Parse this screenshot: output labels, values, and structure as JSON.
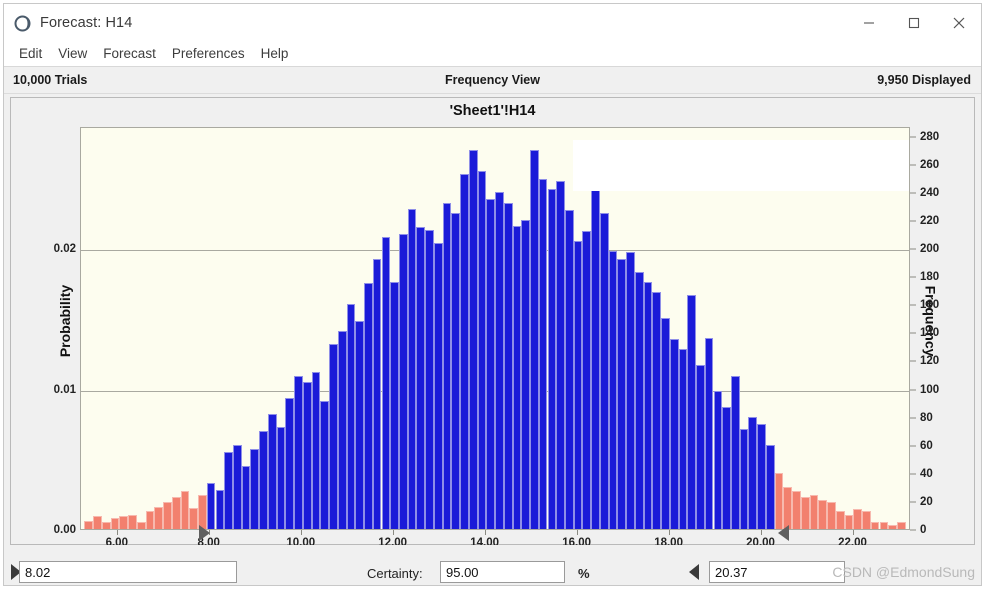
{
  "window": {
    "title": "Forecast: H14",
    "icon": "crystal-ball-icon",
    "minimize_label": "–",
    "maximize_label": "□",
    "close_label": "✕"
  },
  "menubar": {
    "items": [
      {
        "label": "Edit"
      },
      {
        "label": "View"
      },
      {
        "label": "Forecast"
      },
      {
        "label": "Preferences"
      },
      {
        "label": "Help"
      }
    ]
  },
  "status": {
    "trials": "10,000 Trials",
    "view_mode": "Frequency View",
    "displayed": "9,950 Displayed"
  },
  "controls": {
    "lower_bound": "8.02",
    "certainty_label": "Certainty:",
    "certainty_value": "95.00",
    "percent_symbol": "%",
    "upper_bound": "20.37",
    "lower_marker_icon": "triangle-right-icon",
    "upper_marker_icon": "triangle-left-icon",
    "watermark": "CSDN @EdmondSung"
  },
  "colors": {
    "inside_bar": "#1b1bd8",
    "outside_bar": "#f2806e",
    "plot_background": "#fdfdef",
    "panel_background": "#f0f0f0"
  },
  "chart_data": {
    "type": "bar",
    "title": "'Sheet1'!H14",
    "xlabel": "",
    "ylabel": "Probability",
    "y2label": "Frequency",
    "grid": true,
    "legend": "empty-box",
    "xlim": [
      5.2,
      23.25
    ],
    "ylim": [
      0,
      0.0287
    ],
    "y2lim": [
      0,
      287
    ],
    "yticks": [
      0.0,
      0.01,
      0.02
    ],
    "yticklabels": [
      "0.00",
      "0.01",
      "0.02"
    ],
    "y2ticks": [
      0,
      20,
      40,
      60,
      80,
      100,
      120,
      140,
      160,
      180,
      200,
      220,
      240,
      260,
      280
    ],
    "y2ticklabels": [
      "0",
      "20",
      "40",
      "60",
      "80",
      "100",
      "120",
      "140",
      "160",
      "180",
      "200",
      "220",
      "240",
      "260",
      "280"
    ],
    "xticks": [
      6.0,
      8.0,
      10.0,
      12.0,
      14.0,
      16.0,
      18.0,
      20.0,
      22.0
    ],
    "xticklabels": [
      "6.00",
      "8.00",
      "10.00",
      "12.00",
      "14.00",
      "16.00",
      "18.00",
      "20.00",
      "22.00"
    ],
    "total_trials": 10000,
    "displayed_trials": 9950,
    "certainty_percent": 95.0,
    "lower_cut": 8.02,
    "upper_cut": 20.37,
    "bin_width": 0.19,
    "bin_start": 5.27,
    "bin_centers": [
      5.37,
      5.56,
      5.75,
      5.94,
      6.13,
      6.32,
      6.51,
      6.7,
      6.89,
      7.08,
      7.27,
      7.46,
      7.65,
      7.84,
      8.03,
      8.22,
      8.41,
      8.6,
      8.79,
      8.98,
      9.17,
      9.36,
      9.55,
      9.74,
      9.93,
      10.12,
      10.31,
      10.5,
      10.69,
      10.88,
      11.07,
      11.26,
      11.45,
      11.64,
      11.83,
      12.02,
      12.21,
      12.4,
      12.59,
      12.78,
      12.97,
      13.16,
      13.35,
      13.54,
      13.73,
      13.92,
      14.11,
      14.3,
      14.49,
      14.68,
      14.87,
      15.06,
      15.25,
      15.44,
      15.63,
      15.82,
      16.01,
      16.2,
      16.39,
      16.58,
      16.77,
      16.96,
      17.15,
      17.34,
      17.53,
      17.72,
      17.91,
      18.1,
      18.29,
      18.48,
      18.67,
      18.86,
      19.05,
      19.24,
      19.43,
      19.62,
      19.81,
      20.0,
      20.19,
      20.38,
      20.57,
      20.76,
      20.95,
      21.14,
      21.33,
      21.52,
      21.71,
      21.9,
      22.09,
      22.28,
      22.47,
      22.66,
      22.85,
      23.04
    ],
    "frequencies": [
      6,
      9,
      5,
      8,
      9,
      10,
      5,
      13,
      16,
      19,
      23,
      27,
      15,
      24,
      33,
      28,
      55,
      60,
      45,
      57,
      70,
      82,
      73,
      93,
      109,
      105,
      112,
      91,
      132,
      141,
      160,
      148,
      175,
      192,
      208,
      176,
      210,
      228,
      215,
      213,
      204,
      232,
      225,
      253,
      270,
      255,
      235,
      240,
      232,
      216,
      220,
      270,
      249,
      242,
      248,
      227,
      205,
      212,
      243,
      225,
      198,
      192,
      197,
      183,
      176,
      169,
      150,
      135,
      128,
      167,
      117,
      136,
      98,
      87,
      109,
      71,
      80,
      75,
      60,
      40,
      30,
      27,
      23,
      24,
      21,
      19,
      13,
      10,
      14,
      13,
      5,
      5,
      3,
      5
    ],
    "bar_states": [
      "out",
      "out",
      "out",
      "out",
      "out",
      "out",
      "out",
      "out",
      "out",
      "out",
      "out",
      "out",
      "out",
      "out",
      "in",
      "in",
      "in",
      "in",
      "in",
      "in",
      "in",
      "in",
      "in",
      "in",
      "in",
      "in",
      "in",
      "in",
      "in",
      "in",
      "in",
      "in",
      "in",
      "in",
      "in",
      "in",
      "in",
      "in",
      "in",
      "in",
      "in",
      "in",
      "in",
      "in",
      "in",
      "in",
      "in",
      "in",
      "in",
      "in",
      "in",
      "in",
      "in",
      "in",
      "in",
      "in",
      "in",
      "in",
      "in",
      "in",
      "in",
      "in",
      "in",
      "in",
      "in",
      "in",
      "in",
      "in",
      "in",
      "in",
      "in",
      "in",
      "in",
      "in",
      "in",
      "in",
      "in",
      "in",
      "in",
      "out",
      "out",
      "out",
      "out",
      "out",
      "out",
      "out",
      "out",
      "out",
      "out",
      "out",
      "out",
      "out",
      "out",
      "out"
    ]
  }
}
